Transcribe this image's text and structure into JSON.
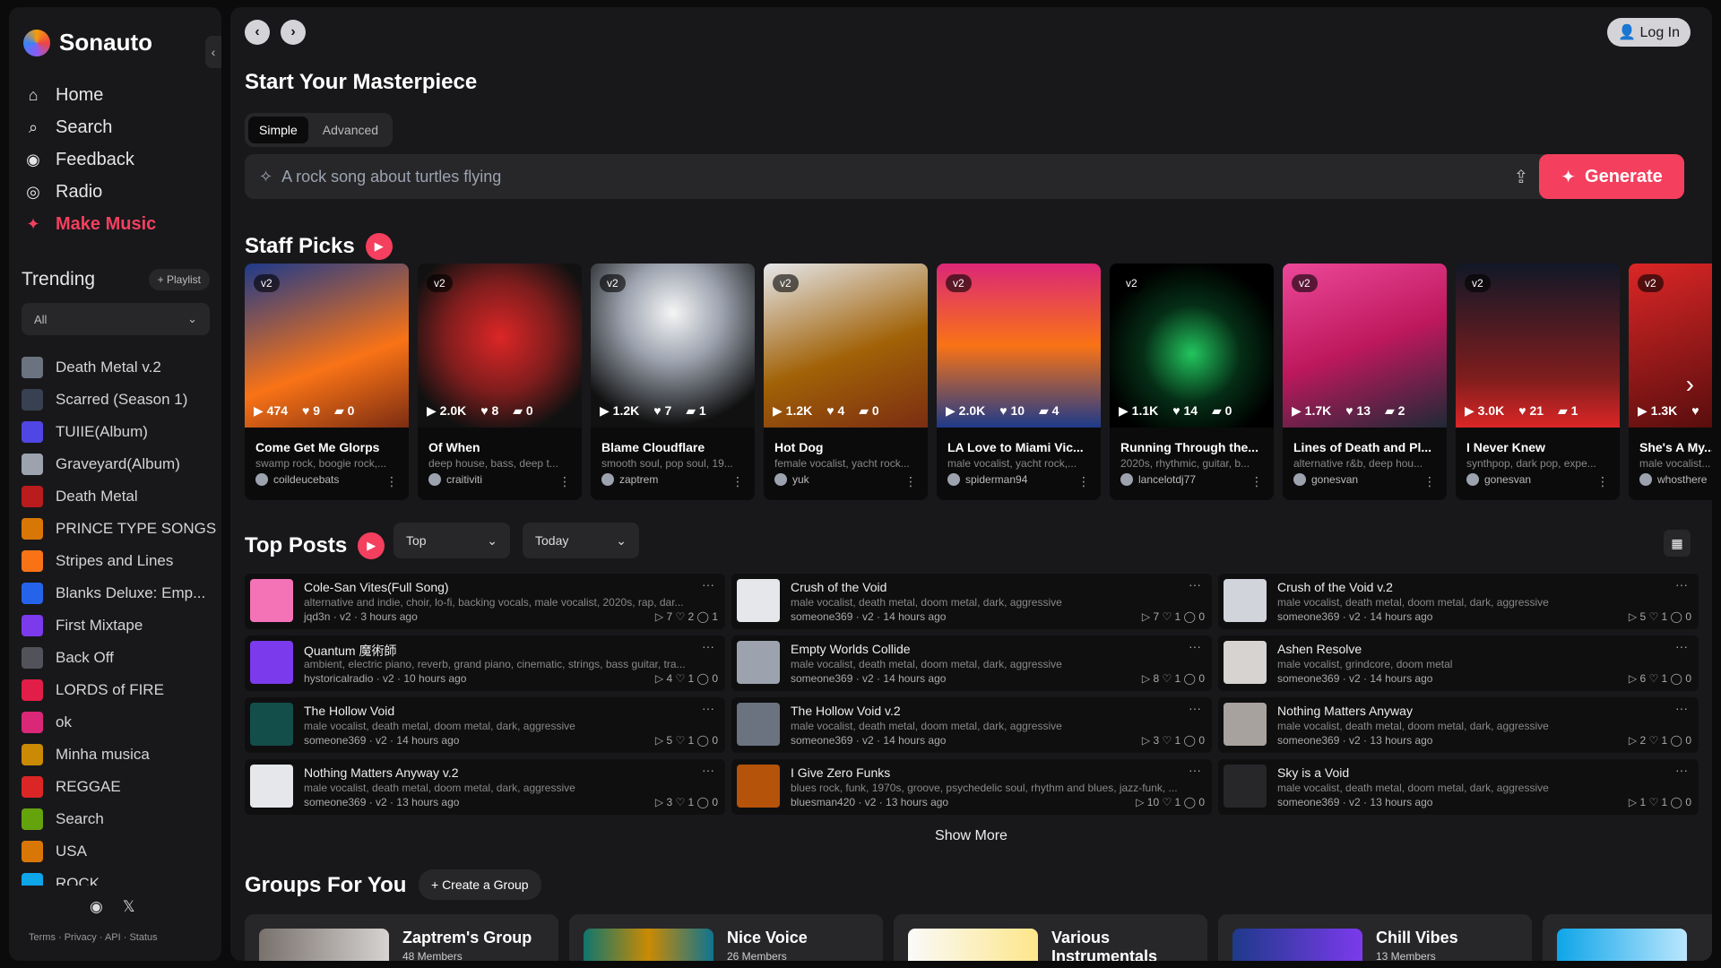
{
  "app": {
    "name": "Sonauto"
  },
  "nav": {
    "items": [
      {
        "label": "Home",
        "icon": "home-icon"
      },
      {
        "label": "Search",
        "icon": "search-icon"
      },
      {
        "label": "Feedback",
        "icon": "discord-icon"
      },
      {
        "label": "Radio",
        "icon": "radio-icon"
      },
      {
        "label": "Make Music",
        "icon": "sparkle-icon"
      }
    ]
  },
  "trending": {
    "title": "Trending",
    "playlist_button": "+ Playlist",
    "filter": "All"
  },
  "playlists": [
    {
      "label": "Death Metal v.2",
      "color": "#6b7280"
    },
    {
      "label": "Scarred (Season 1)",
      "color": "#374151"
    },
    {
      "label": "TUIIE(Album)",
      "color": "#4f46e5"
    },
    {
      "label": "Graveyard(Album)",
      "color": "#9ca3af"
    },
    {
      "label": "Death Metal",
      "color": "#b91c1c"
    },
    {
      "label": "PRINCE TYPE SONGS",
      "color": "#d97706"
    },
    {
      "label": "Stripes and Lines",
      "color": "#f97316"
    },
    {
      "label": "Blanks Deluxe: Emp...",
      "color": "#2563eb"
    },
    {
      "label": "First Mixtape",
      "color": "#7c3aed"
    },
    {
      "label": "Back Off",
      "color": "#52525b"
    },
    {
      "label": "LORDS of FIRE",
      "color": "#e11d48"
    },
    {
      "label": "ok",
      "color": "#db2777"
    },
    {
      "label": "Minha musica",
      "color": "#ca8a04"
    },
    {
      "label": "REGGAE",
      "color": "#dc2626"
    },
    {
      "label": "Search",
      "color": "#65a30d"
    },
    {
      "label": "USA",
      "color": "#d97706"
    },
    {
      "label": "ROCK",
      "color": "#0ea5e9"
    }
  ],
  "footer": {
    "links": "Terms · Privacy · API · Status"
  },
  "header": {
    "back": "‹",
    "forward": "›",
    "login": "Log In"
  },
  "create": {
    "title": "Start Your Masterpiece",
    "tabs": [
      "Simple",
      "Advanced"
    ],
    "placeholder": "A rock song about turtles flying",
    "generate": "Generate"
  },
  "staff_picks": {
    "title": "Staff Picks",
    "cards": [
      {
        "badge": "v2",
        "plays": "474",
        "likes": "9",
        "comments": "0",
        "title": "Come Get Me Glorps",
        "tags": "swamp rock, boogie rock,...",
        "author": "coildeucebats",
        "bg": "linear-gradient(160deg,#1e3a8a,#f97316 60%,#7c2d12)"
      },
      {
        "badge": "v2",
        "plays": "2.0K",
        "likes": "8",
        "comments": "0",
        "title": "Of When",
        "tags": "deep house, bass, deep t...",
        "author": "craitiviti",
        "bg": "radial-gradient(circle at 50% 45%,#dc2626,#7f1d1d 45%,#111 80%)"
      },
      {
        "badge": "v2",
        "plays": "1.2K",
        "likes": "7",
        "comments": "1",
        "title": "Blame Cloudflare",
        "tags": "smooth soul, pop soul, 19...",
        "author": "zaptrem",
        "bg": "radial-gradient(circle at 50% 30%,#f5f5f5,#9ca3af 35%,#111 80%)"
      },
      {
        "badge": "v2",
        "plays": "1.2K",
        "likes": "4",
        "comments": "0",
        "title": "Hot Dog",
        "tags": "female vocalist, yacht rock...",
        "author": "yuk",
        "bg": "linear-gradient(160deg,#e5e7eb,#a16207 55%,#7c2d12)"
      },
      {
        "badge": "v2",
        "plays": "2.0K",
        "likes": "10",
        "comments": "4",
        "title": "LA Love to Miami Vic...",
        "tags": "male vocalist, yacht rock,...",
        "author": "spiderman94",
        "bg": "linear-gradient(180deg,#db2777,#f97316 50%,#1e3a8a)"
      },
      {
        "badge": "v2",
        "plays": "1.1K",
        "likes": "14",
        "comments": "0",
        "title": "Running Through the...",
        "tags": "2020s, rhythmic, guitar, b...",
        "author": "lancelotdj77",
        "bg": "radial-gradient(circle at 50% 55%,#22c55e,#052e16 40%,#000 75%)"
      },
      {
        "badge": "v2",
        "plays": "1.7K",
        "likes": "13",
        "comments": "2",
        "title": "Lines of Death and Pl...",
        "tags": "alternative r&b, deep hou...",
        "author": "gonesvan",
        "bg": "linear-gradient(160deg,#ec4899,#be185d 50%,#1f2937)"
      },
      {
        "badge": "v2",
        "plays": "3.0K",
        "likes": "21",
        "comments": "1",
        "title": "I Never Knew",
        "tags": "synthpop, dark pop, expe...",
        "author": "gonesvan",
        "bg": "linear-gradient(180deg,#111827,#7f1d1d 70%,#dc2626)"
      },
      {
        "badge": "v2",
        "plays": "1.3K",
        "likes": "",
        "comments": "",
        "title": "She's A My...",
        "tags": "male vocalist...",
        "author": "whosthere",
        "bg": "linear-gradient(160deg,#dc2626,#450a0a)"
      }
    ]
  },
  "top_posts": {
    "title": "Top Posts",
    "sort": "Top",
    "range": "Today",
    "show_more": "Show More",
    "posts": [
      {
        "title": "Cole-San Vites(Full Song)",
        "tags": "alternative and indie, choir, lo-fi, backing vocals, male vocalist, 2020s, rap, dar...",
        "meta": "jqd3n · v2 · 3 hours ago",
        "stats": "▷ 7 ♡ 2 ◯ 1",
        "color": "#f472b6"
      },
      {
        "title": "Crush of the Void",
        "tags": "male vocalist, death metal, doom metal, dark, aggressive",
        "meta": "someone369 · v2 · 14 hours ago",
        "stats": "▷ 7 ♡ 1 ◯ 0",
        "color": "#e5e7eb"
      },
      {
        "title": "Crush of the Void v.2",
        "tags": "male vocalist, death metal, doom metal, dark, aggressive",
        "meta": "someone369 · v2 · 14 hours ago",
        "stats": "▷ 5 ♡ 1 ◯ 0",
        "color": "#d1d5db"
      },
      {
        "title": "Quantum 魔術師",
        "tags": "ambient, electric piano, reverb, grand piano, cinematic, strings, bass guitar, tra...",
        "meta": "hystoricalradio · v2 · 10 hours ago",
        "stats": "▷ 4 ♡ 1 ◯ 0",
        "color": "#7c3aed"
      },
      {
        "title": "Empty Worlds Collide",
        "tags": "male vocalist, death metal, doom metal, dark, aggressive",
        "meta": "someone369 · v2 · 14 hours ago",
        "stats": "▷ 8 ♡ 1 ◯ 0",
        "color": "#9ca3af"
      },
      {
        "title": "Ashen Resolve",
        "tags": "male vocalist, grindcore, doom metal",
        "meta": "someone369 · v2 · 14 hours ago",
        "stats": "▷ 6 ♡ 1 ◯ 0",
        "color": "#d6d3d1"
      },
      {
        "title": "The Hollow Void",
        "tags": "male vocalist, death metal, doom metal, dark, aggressive",
        "meta": "someone369 · v2 · 14 hours ago",
        "stats": "▷ 5 ♡ 1 ◯ 0",
        "color": "#134e4a"
      },
      {
        "title": "The Hollow Void v.2",
        "tags": "male vocalist, death metal, doom metal, dark, aggressive",
        "meta": "someone369 · v2 · 14 hours ago",
        "stats": "▷ 3 ♡ 1 ◯ 0",
        "color": "#6b7280"
      },
      {
        "title": "Nothing Matters Anyway",
        "tags": "male vocalist, death metal, doom metal, dark, aggressive",
        "meta": "someone369 · v2 · 13 hours ago",
        "stats": "▷ 2 ♡ 1 ◯ 0",
        "color": "#a8a29e"
      },
      {
        "title": "Nothing Matters Anyway v.2",
        "tags": "male vocalist, death metal, doom metal, dark, aggressive",
        "meta": "someone369 · v2 · 13 hours ago",
        "stats": "▷ 3 ♡ 1 ◯ 0",
        "color": "#e5e7eb"
      },
      {
        "title": "I Give Zero Funks",
        "tags": "blues rock, funk, 1970s, groove, psychedelic soul, rhythm and blues, jazz-funk, ...",
        "meta": "bluesman420 · v2 · 13 hours ago",
        "stats": "▷ 10 ♡ 1 ◯ 0",
        "color": "#b45309"
      },
      {
        "title": "Sky is a Void",
        "tags": "male vocalist, death metal, doom metal, dark, aggressive",
        "meta": "someone369 · v2 · 13 hours ago",
        "stats": "▷ 1 ♡ 1 ◯ 0",
        "color": "#27272a"
      }
    ]
  },
  "groups": {
    "title": "Groups For You",
    "create": "+ Create a Group",
    "items": [
      {
        "name": "Zaptrem's Group",
        "members": "48 Members",
        "bg": "linear-gradient(90deg,#78716c,#d6d3d1)"
      },
      {
        "name": "Nice Voice",
        "members": "26 Members",
        "bg": "linear-gradient(90deg,#0f766e,#ca8a04 50%,#0e7490)"
      },
      {
        "name": "Various Instrumentals",
        "members": "",
        "bg": "linear-gradient(90deg,#fafaf9,#fde68a)"
      },
      {
        "name": "Chill Vibes",
        "members": "13 Members",
        "bg": "linear-gradient(90deg,#1e3a8a,#7c3aed)"
      },
      {
        "name": "",
        "members": "",
        "bg": "linear-gradient(90deg,#0ea5e9,#bae6fd)"
      }
    ]
  }
}
